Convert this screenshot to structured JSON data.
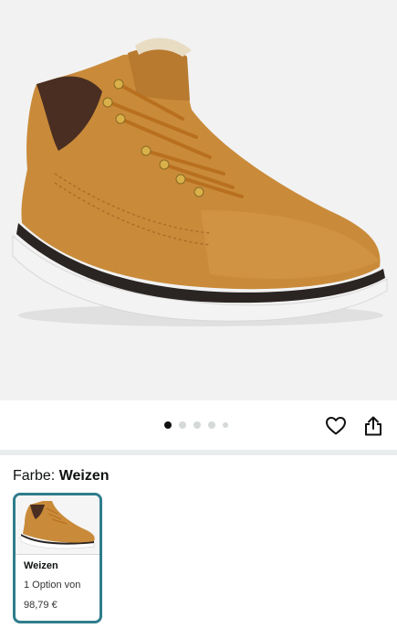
{
  "product_image": {
    "icon": "boot-product-image",
    "background": "#f2f2f2"
  },
  "carousel": {
    "dot_count": 5,
    "active_index": 0
  },
  "actions": {
    "heart_icon": "heart-icon",
    "share_icon": "share-icon"
  },
  "color_selector": {
    "label": "Farbe: ",
    "selected_value": "Weizen",
    "swatches": [
      {
        "name": "Weizen",
        "options": "1 Option von",
        "price": "98,79 €",
        "selected": true
      }
    ]
  },
  "colors": {
    "accent_border": "#2f7d8c",
    "boot_leather": "#c98b3a",
    "sole": "#f4f4f4"
  }
}
